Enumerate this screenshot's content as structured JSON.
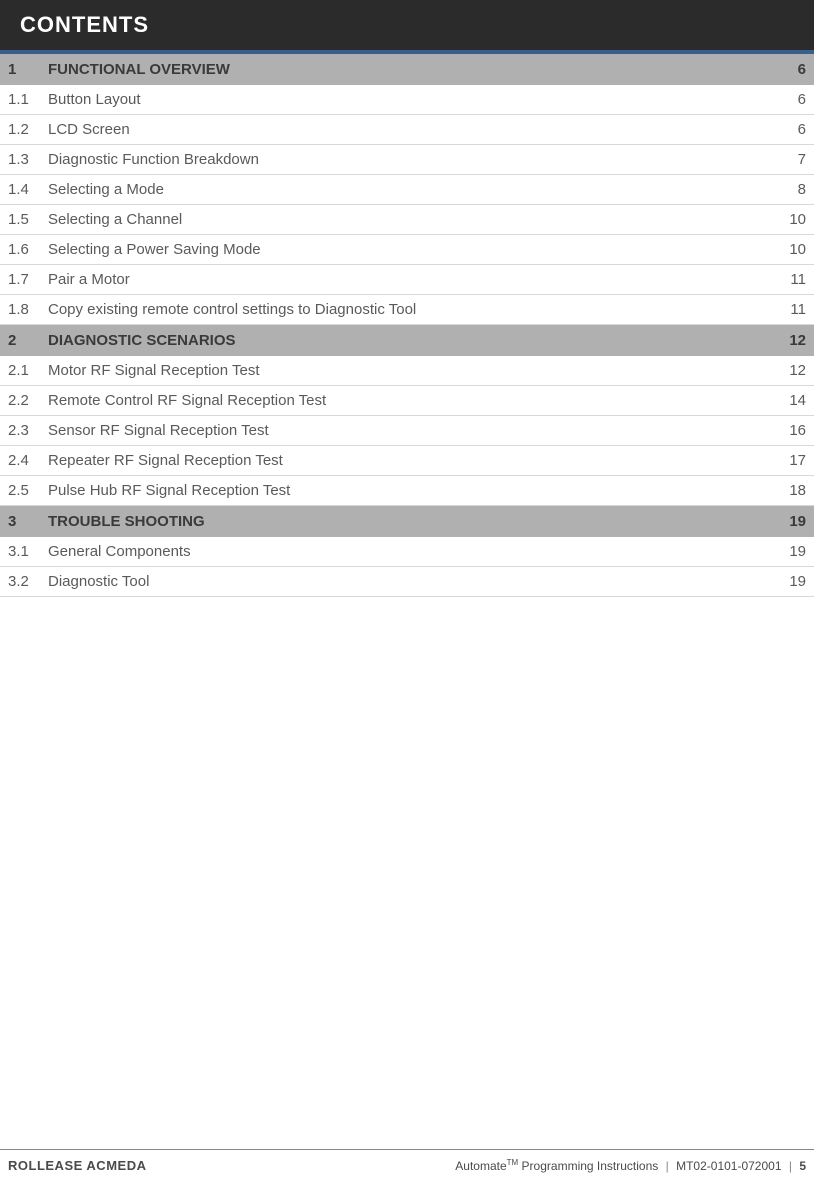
{
  "header": {
    "title": "CONTENTS"
  },
  "sections": [
    {
      "num": "1",
      "title": "FUNCTIONAL OVERVIEW",
      "page": "6",
      "items": [
        {
          "num": "1.1",
          "title": "Button Layout",
          "page": "6"
        },
        {
          "num": "1.2",
          "title": "LCD Screen",
          "page": "6"
        },
        {
          "num": "1.3",
          "title": "Diagnostic Function Breakdown",
          "page": "7"
        },
        {
          "num": "1.4",
          "title": "Selecting a Mode",
          "page": "8"
        },
        {
          "num": "1.5",
          "title": "Selecting a Channel",
          "page": "10"
        },
        {
          "num": "1.6",
          "title": "Selecting a Power Saving Mode",
          "page": "10"
        },
        {
          "num": "1.7",
          "title": "Pair a Motor",
          "page": "11"
        },
        {
          "num": "1.8",
          "title": "Copy existing remote control settings to Diagnostic Tool",
          "page": "11"
        }
      ]
    },
    {
      "num": "2",
      "title": "DIAGNOSTIC SCENARIOS",
      "page": "12",
      "items": [
        {
          "num": "2.1",
          "title": "Motor RF Signal Reception Test",
          "page": "12"
        },
        {
          "num": "2.2",
          "title": "Remote Control RF Signal Reception Test",
          "page": "14"
        },
        {
          "num": "2.3",
          "title": "Sensor RF Signal Reception Test",
          "page": "16"
        },
        {
          "num": "2.4",
          "title": "Repeater RF Signal Reception Test",
          "page": "17"
        },
        {
          "num": "2.5",
          "title": "Pulse Hub RF Signal Reception Test",
          "page": "18"
        }
      ]
    },
    {
      "num": "3",
      "title": "TROUBLE SHOOTING",
      "page": "19",
      "items": [
        {
          "num": "3.1",
          "title": "General Components",
          "page": "19"
        },
        {
          "num": "3.2",
          "title": "Diagnostic Tool",
          "page": "19"
        }
      ]
    }
  ],
  "footer": {
    "brand": "ROLLEASE ACMEDA",
    "product": "Automate",
    "tm": "TM",
    "doc_title": " Programming Instructions",
    "doc_code": "MT02-0101-072001",
    "page_num": "5"
  }
}
